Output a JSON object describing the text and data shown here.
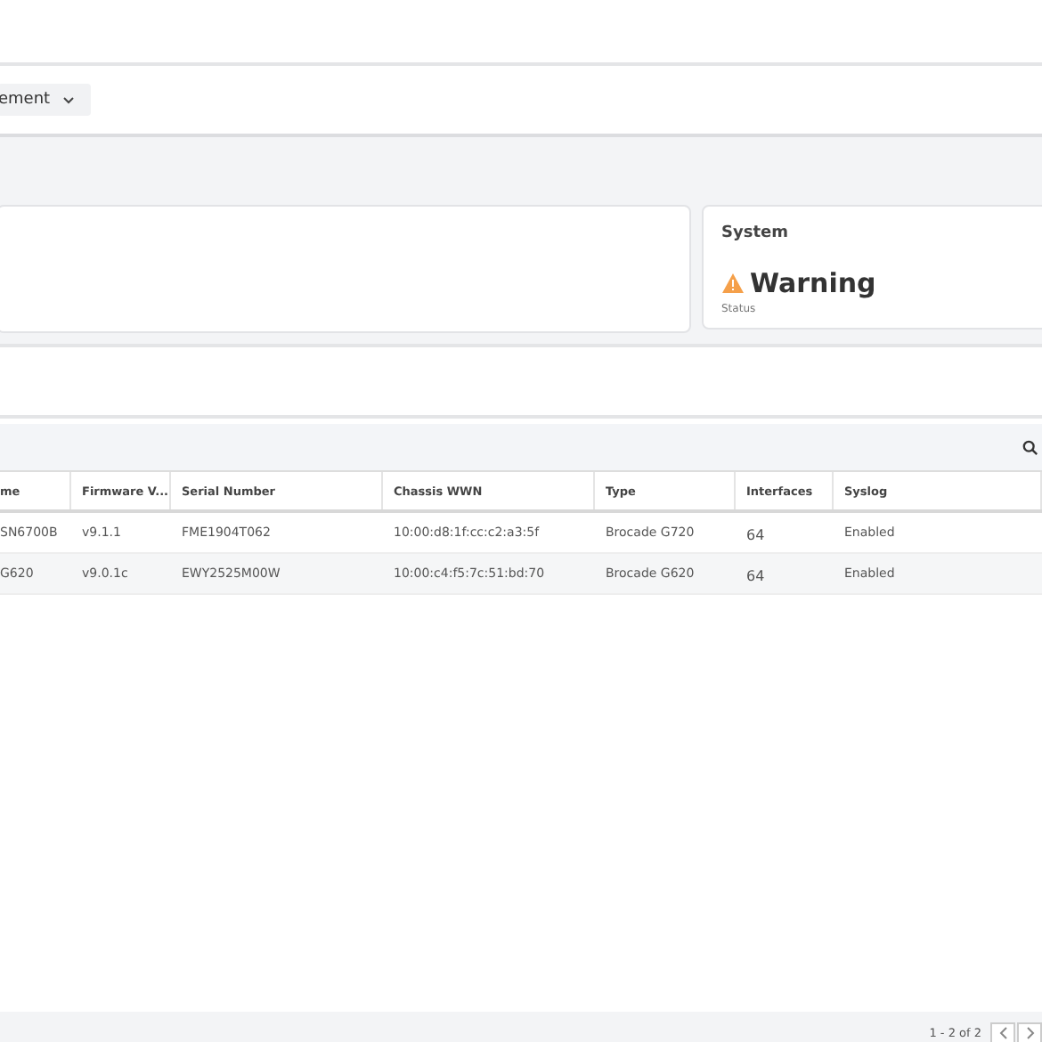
{
  "filter": {
    "label": "ement"
  },
  "system_card": {
    "title": "System",
    "status": "Warning",
    "caption": "Status"
  },
  "table": {
    "columns": [
      "me",
      "Firmware V...",
      "Serial Number",
      "Chassis WWN",
      "Type",
      "Interfaces",
      "Syslog"
    ],
    "rows": [
      [
        "SN6700B",
        "v9.1.1",
        "FME1904T062",
        "10:00:d8:1f:cc:c2:a3:5f",
        "Brocade G720",
        "64",
        "Enabled"
      ],
      [
        "G620",
        "v9.0.1c",
        "EWY2525M00W",
        "10:00:c4:f5:7c:51:bd:70",
        "Brocade G620",
        "64",
        "Enabled"
      ]
    ]
  },
  "pagination": {
    "range": "1 - 2 of 2"
  }
}
